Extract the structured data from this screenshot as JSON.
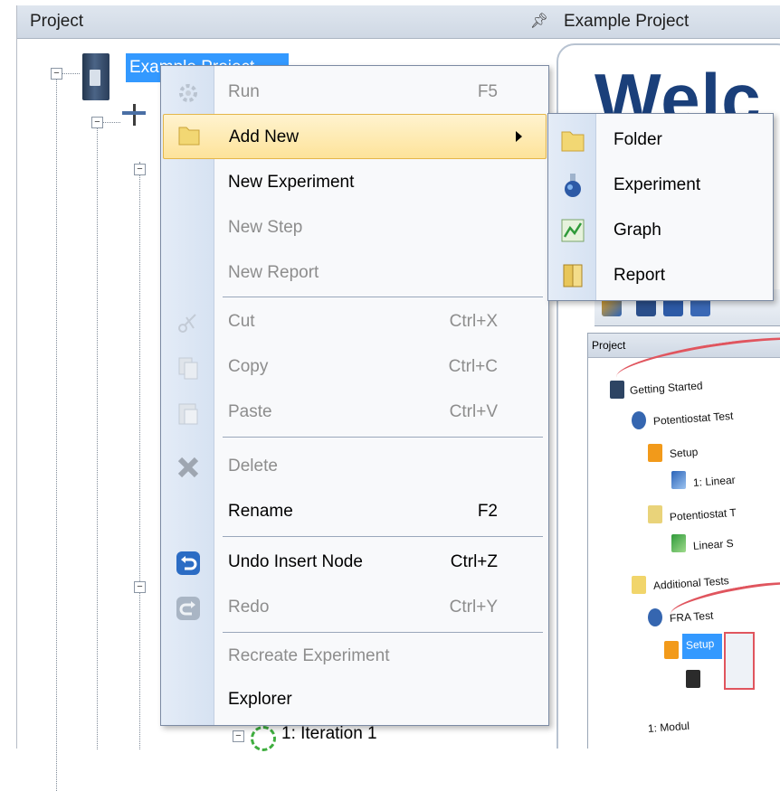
{
  "left_panel": {
    "title": "Project",
    "pin_glyph": "☉"
  },
  "tree": {
    "root_label": "Example Project",
    "iteration_label": "1: Iteration 1"
  },
  "right_panel": {
    "title": "Example Project",
    "welcome_text": "Welc",
    "mini_panel": {
      "header": "Project",
      "items": [
        "Getting Started",
        "Potentiostat Test",
        "Setup",
        "1: Linear",
        "Potentiostat T",
        "Linear S",
        "Additional Tests",
        "FRA Test",
        "Setup",
        "1: Modul"
      ]
    }
  },
  "context_menu": {
    "items": [
      {
        "label": "Run",
        "shortcut": "F5",
        "enabled": false,
        "icon": "run-gear-icon"
      },
      {
        "label": "Add New",
        "shortcut": "",
        "enabled": true,
        "highlighted": true,
        "submenu": true,
        "icon": "folder-icon"
      },
      {
        "label": "New Experiment",
        "shortcut": "",
        "enabled": true,
        "icon": ""
      },
      {
        "label": "New Step",
        "shortcut": "",
        "enabled": false,
        "icon": ""
      },
      {
        "label": "New Report",
        "shortcut": "",
        "enabled": false,
        "icon": ""
      },
      {
        "label": "Cut",
        "shortcut": "Ctrl+X",
        "enabled": false,
        "icon": "scissors-icon"
      },
      {
        "label": "Copy",
        "shortcut": "Ctrl+C",
        "enabled": false,
        "icon": "copy-icon"
      },
      {
        "label": "Paste",
        "shortcut": "Ctrl+V",
        "enabled": false,
        "icon": "paste-icon"
      },
      {
        "label": "Delete",
        "shortcut": "",
        "enabled": false,
        "icon": "delete-x-icon"
      },
      {
        "label": "Rename",
        "shortcut": "F2",
        "enabled": true,
        "icon": ""
      },
      {
        "label": "Undo Insert Node",
        "shortcut": "Ctrl+Z",
        "enabled": true,
        "icon": "undo-icon"
      },
      {
        "label": "Redo",
        "shortcut": "Ctrl+Y",
        "enabled": false,
        "icon": "redo-icon"
      },
      {
        "label": "Recreate Experiment",
        "shortcut": "",
        "enabled": false,
        "icon": ""
      },
      {
        "label": "Explorer",
        "shortcut": "",
        "enabled": true,
        "icon": ""
      }
    ]
  },
  "submenu": {
    "items": [
      {
        "label": "Folder",
        "icon": "folder-icon"
      },
      {
        "label": "Experiment",
        "icon": "experiment-flask-icon"
      },
      {
        "label": "Graph",
        "icon": "graph-icon"
      },
      {
        "label": "Report",
        "icon": "report-book-icon"
      }
    ]
  },
  "colors": {
    "selection": "#3399ff",
    "menu_highlight": "#fde39a",
    "disabled_text": "#8d8d8d",
    "welcome": "#1a3f7a"
  }
}
